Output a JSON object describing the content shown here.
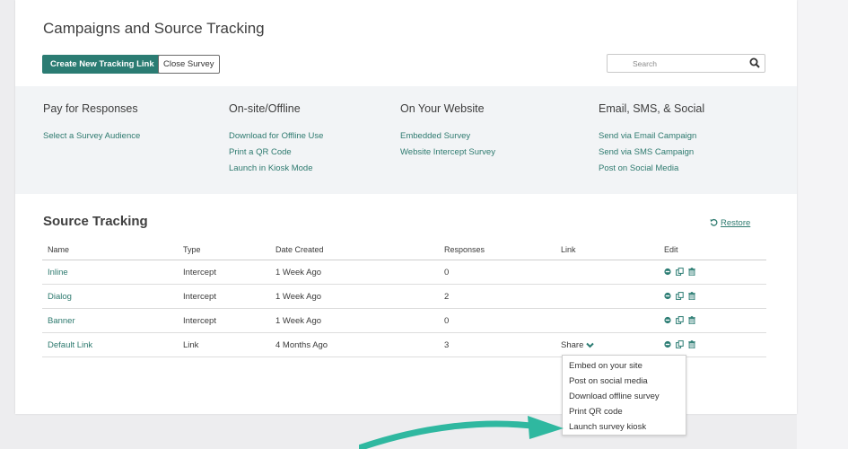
{
  "page_title": "Campaigns and Source Tracking",
  "toolbar": {
    "create_label": "Create New Tracking Link",
    "close_label": "Close Survey",
    "search_placeholder": "Search"
  },
  "distribute": [
    {
      "heading": "Pay for Responses",
      "links": [
        "Select a Survey Audience"
      ]
    },
    {
      "heading": "On-site/Offline",
      "links": [
        "Download for Offline Use",
        "Print a QR Code",
        "Launch in Kiosk Mode"
      ]
    },
    {
      "heading": "On Your Website",
      "links": [
        "Embedded Survey",
        "Website Intercept Survey"
      ]
    },
    {
      "heading": "Email, SMS, & Social",
      "links": [
        "Send via Email Campaign",
        "Send via SMS Campaign",
        "Post on Social Media"
      ]
    }
  ],
  "source_tracking": {
    "title": "Source Tracking",
    "restore_label": "Restore",
    "columns": [
      "Name",
      "Type",
      "Date Created",
      "Responses",
      "Link",
      "Edit"
    ],
    "rows": [
      {
        "name": "Inline",
        "type": "Intercept",
        "date": "1 Week Ago",
        "responses": "0",
        "link": ""
      },
      {
        "name": "Dialog",
        "type": "Intercept",
        "date": "1 Week Ago",
        "responses": "2",
        "link": ""
      },
      {
        "name": "Banner",
        "type": "Intercept",
        "date": "1 Week Ago",
        "responses": "0",
        "link": ""
      },
      {
        "name": "Default Link",
        "type": "Link",
        "date": "4 Months Ago",
        "responses": "3",
        "link": "Share"
      }
    ]
  },
  "share_menu": [
    "Embed on your site",
    "Post on social media",
    "Download offline survey",
    "Print QR code",
    "Launch survey kiosk"
  ],
  "colors": {
    "accent": "#2b7c73",
    "link": "#2e7a6f",
    "arrow": "#2fb8a0"
  }
}
